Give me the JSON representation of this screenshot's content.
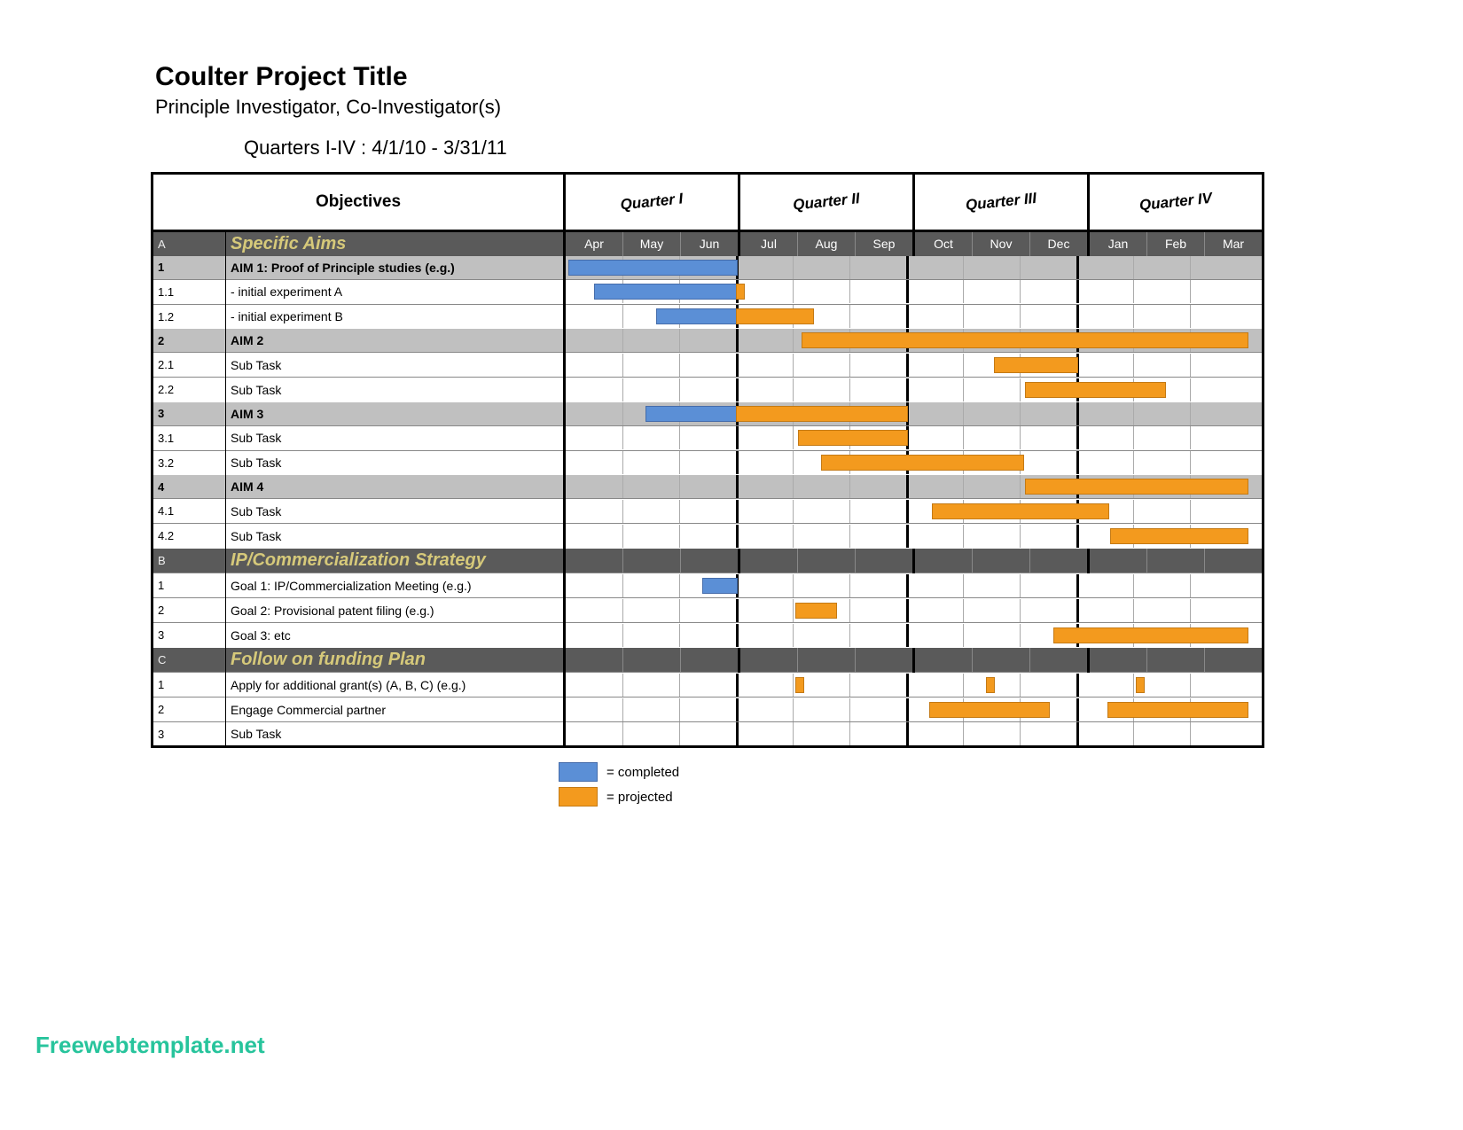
{
  "header": {
    "title": "Coulter Project Title",
    "subtitle": "Principle Investigator, Co-Investigator(s)",
    "range": "Quarters I-IV : 4/1/10 - 3/31/11"
  },
  "table": {
    "objectivesHeader": "Objectives",
    "quarters": [
      "Quarter I",
      "Quarter II",
      "Quarter III",
      "Quarter IV"
    ],
    "months": [
      "Apr",
      "May",
      "Jun",
      "Jul",
      "Aug",
      "Sep",
      "Oct",
      "Nov",
      "Dec",
      "Jan",
      "Feb",
      "Mar"
    ]
  },
  "rows": [
    {
      "type": "section",
      "id": "A",
      "label": "Specific Aims"
    },
    {
      "type": "aim",
      "id": "1",
      "label": "AIM 1: Proof of Principle studies (e.g.)",
      "bars": [
        {
          "color": "blue",
          "start": 0,
          "end": 3,
          "off": 0.05
        }
      ]
    },
    {
      "type": "task",
      "id": "1.1",
      "label": " - initial experiment A",
      "bars": [
        {
          "color": "blue",
          "start": 0,
          "end": 3,
          "off": 0.5
        },
        {
          "color": "orange",
          "start": 3,
          "end": 3,
          "off": 0,
          "w": 0.5
        }
      ]
    },
    {
      "type": "task",
      "id": "1.2",
      "label": " - initial experiment B",
      "bars": [
        {
          "color": "blue",
          "start": 1,
          "end": 3,
          "off": 0.6
        },
        {
          "color": "orange",
          "start": 3,
          "end": 5,
          "off": 0,
          "w": 0.35
        }
      ]
    },
    {
      "type": "aim",
      "id": "2",
      "label": "AIM 2",
      "bars": [
        {
          "color": "orange",
          "start": 4,
          "end": 12,
          "off": 0.15
        }
      ]
    },
    {
      "type": "task",
      "id": "2.1",
      "label": "Sub Task",
      "bars": [
        {
          "color": "orange",
          "start": 7,
          "end": 9,
          "off": 0.55
        }
      ]
    },
    {
      "type": "task",
      "id": "2.2",
      "label": "Sub Task",
      "bars": [
        {
          "color": "orange",
          "start": 8,
          "end": 11,
          "off": 0.1,
          "w": 0.45
        }
      ]
    },
    {
      "type": "aim",
      "id": "3",
      "label": "AIM 3",
      "bars": [
        {
          "color": "blue",
          "start": 1,
          "end": 3,
          "off": 0.4
        },
        {
          "color": "orange",
          "start": 3,
          "end": 6,
          "off": 0
        }
      ]
    },
    {
      "type": "task",
      "id": "3.1",
      "label": "Sub Task",
      "bars": [
        {
          "color": "orange",
          "start": 4,
          "end": 6,
          "off": 0.1
        }
      ]
    },
    {
      "type": "task",
      "id": "3.2",
      "label": "Sub Task",
      "bars": [
        {
          "color": "orange",
          "start": 4,
          "end": 8,
          "off": 0.5,
          "w": 0.55
        }
      ]
    },
    {
      "type": "aim",
      "id": "4",
      "label": "AIM 4",
      "bars": [
        {
          "color": "orange",
          "start": 8,
          "end": 12,
          "off": 0.1
        }
      ]
    },
    {
      "type": "task",
      "id": "4.1",
      "label": "Sub Task",
      "bars": [
        {
          "color": "orange",
          "start": 6,
          "end": 10,
          "off": 0.45,
          "w": 0.1
        }
      ]
    },
    {
      "type": "task",
      "id": "4.2",
      "label": "Sub Task",
      "bars": [
        {
          "color": "orange",
          "start": 9,
          "end": 12,
          "off": 0.6
        }
      ]
    },
    {
      "type": "section",
      "id": "B",
      "label": "IP/Commercialization Strategy"
    },
    {
      "type": "task",
      "id": "1",
      "label": "Goal 1: IP/Commercialization Meeting (e.g.)",
      "bars": [
        {
          "color": "blue",
          "start": 2,
          "end": 3,
          "off": 0.4
        }
      ]
    },
    {
      "type": "task",
      "id": "2",
      "label": "Goal 2: Provisional patent filing (e.g.)",
      "bars": [
        {
          "color": "orange",
          "start": 4,
          "end": 5,
          "off": 0.05,
          "w": 0.7
        }
      ]
    },
    {
      "type": "task",
      "id": "3",
      "label": "Goal 3: etc",
      "bars": [
        {
          "color": "orange",
          "start": 8,
          "end": 12,
          "off": 0.6
        }
      ]
    },
    {
      "type": "section",
      "id": "C",
      "label": "Follow on funding Plan"
    },
    {
      "type": "task",
      "id": "1",
      "label": "Apply for additional grant(s) (A, B, C) (e.g.)",
      "bars": [
        {
          "color": "orange",
          "start": 4,
          "end": 4,
          "off": 0.05,
          "w": 0.5
        },
        {
          "color": "orange",
          "start": 7,
          "end": 7,
          "off": 0.4,
          "w": 0.5
        },
        {
          "color": "orange",
          "start": 10,
          "end": 10,
          "off": 0.05,
          "w": 0.5
        }
      ]
    },
    {
      "type": "task",
      "id": "2",
      "label": "Engage Commercial partner",
      "bars": [
        {
          "color": "orange",
          "start": 6,
          "end": 9,
          "off": 0.4,
          "w": 0.1
        },
        {
          "color": "orange",
          "start": 9,
          "end": 12,
          "off": 0.55
        }
      ]
    },
    {
      "type": "task",
      "id": "3",
      "label": "Sub Task",
      "bars": []
    }
  ],
  "legend": {
    "completed": "= completed",
    "projected": "= projected"
  },
  "footer": "Freewebtemplate.net",
  "colors": {
    "blue": "#5b8fd6",
    "orange": "#f39a1e"
  },
  "chart_data": {
    "type": "gantt",
    "title": "Coulter Project Title — Quarters I-IV : 4/1/10 - 3/31/11",
    "x_categories": [
      "Apr",
      "May",
      "Jun",
      "Jul",
      "Aug",
      "Sep",
      "Oct",
      "Nov",
      "Dec",
      "Jan",
      "Feb",
      "Mar"
    ],
    "x_groups": {
      "Quarter I": [
        "Apr",
        "May",
        "Jun"
      ],
      "Quarter II": [
        "Jul",
        "Aug",
        "Sep"
      ],
      "Quarter III": [
        "Oct",
        "Nov",
        "Dec"
      ],
      "Quarter IV": [
        "Jan",
        "Feb",
        "Mar"
      ]
    },
    "status_colors": {
      "completed": "#5b8fd6",
      "projected": "#f39a1e"
    },
    "tasks": [
      {
        "section": "Specific Aims",
        "id": "1",
        "name": "AIM 1: Proof of Principle studies (e.g.)",
        "bars": [
          {
            "status": "completed",
            "start": "Apr",
            "end": "Jun"
          }
        ]
      },
      {
        "section": "Specific Aims",
        "id": "1.1",
        "name": "initial experiment A",
        "bars": [
          {
            "status": "completed",
            "start": "Apr",
            "end": "Jun"
          },
          {
            "status": "projected",
            "start": "Jul",
            "end": "Jul"
          }
        ]
      },
      {
        "section": "Specific Aims",
        "id": "1.2",
        "name": "initial experiment B",
        "bars": [
          {
            "status": "completed",
            "start": "May",
            "end": "Jun"
          },
          {
            "status": "projected",
            "start": "Jul",
            "end": "Aug"
          }
        ]
      },
      {
        "section": "Specific Aims",
        "id": "2",
        "name": "AIM 2",
        "bars": [
          {
            "status": "projected",
            "start": "Aug",
            "end": "Mar"
          }
        ]
      },
      {
        "section": "Specific Aims",
        "id": "2.1",
        "name": "Sub Task",
        "bars": [
          {
            "status": "projected",
            "start": "Nov",
            "end": "Dec"
          }
        ]
      },
      {
        "section": "Specific Aims",
        "id": "2.2",
        "name": "Sub Task",
        "bars": [
          {
            "status": "projected",
            "start": "Dec",
            "end": "Feb"
          }
        ]
      },
      {
        "section": "Specific Aims",
        "id": "3",
        "name": "AIM 3",
        "bars": [
          {
            "status": "completed",
            "start": "May",
            "end": "Jun"
          },
          {
            "status": "projected",
            "start": "Jul",
            "end": "Sep"
          }
        ]
      },
      {
        "section": "Specific Aims",
        "id": "3.1",
        "name": "Sub Task",
        "bars": [
          {
            "status": "projected",
            "start": "Aug",
            "end": "Sep"
          }
        ]
      },
      {
        "section": "Specific Aims",
        "id": "3.2",
        "name": "Sub Task",
        "bars": [
          {
            "status": "projected",
            "start": "Aug",
            "end": "Nov"
          }
        ]
      },
      {
        "section": "Specific Aims",
        "id": "4",
        "name": "AIM 4",
        "bars": [
          {
            "status": "projected",
            "start": "Dec",
            "end": "Mar"
          }
        ]
      },
      {
        "section": "Specific Aims",
        "id": "4.1",
        "name": "Sub Task",
        "bars": [
          {
            "status": "projected",
            "start": "Oct",
            "end": "Jan"
          }
        ]
      },
      {
        "section": "Specific Aims",
        "id": "4.2",
        "name": "Sub Task",
        "bars": [
          {
            "status": "projected",
            "start": "Jan",
            "end": "Mar"
          }
        ]
      },
      {
        "section": "IP/Commercialization Strategy",
        "id": "1",
        "name": "Goal 1: IP/Commercialization Meeting (e.g.)",
        "bars": [
          {
            "status": "completed",
            "start": "Jun",
            "end": "Jun"
          }
        ]
      },
      {
        "section": "IP/Commercialization Strategy",
        "id": "2",
        "name": "Goal 2: Provisional patent filing (e.g.)",
        "bars": [
          {
            "status": "projected",
            "start": "Aug",
            "end": "Aug"
          }
        ]
      },
      {
        "section": "IP/Commercialization Strategy",
        "id": "3",
        "name": "Goal 3: etc",
        "bars": [
          {
            "status": "projected",
            "start": "Dec",
            "end": "Mar"
          }
        ]
      },
      {
        "section": "Follow on funding Plan",
        "id": "1",
        "name": "Apply for additional grant(s) (A, B, C) (e.g.)",
        "bars": [
          {
            "status": "projected",
            "start": "Aug",
            "end": "Aug"
          },
          {
            "status": "projected",
            "start": "Nov",
            "end": "Nov"
          },
          {
            "status": "projected",
            "start": "Feb",
            "end": "Feb"
          }
        ]
      },
      {
        "section": "Follow on funding Plan",
        "id": "2",
        "name": "Engage Commercial partner",
        "bars": [
          {
            "status": "projected",
            "start": "Oct",
            "end": "Dec"
          },
          {
            "status": "projected",
            "start": "Jan",
            "end": "Mar"
          }
        ]
      },
      {
        "section": "Follow on funding Plan",
        "id": "3",
        "name": "Sub Task",
        "bars": []
      }
    ]
  }
}
